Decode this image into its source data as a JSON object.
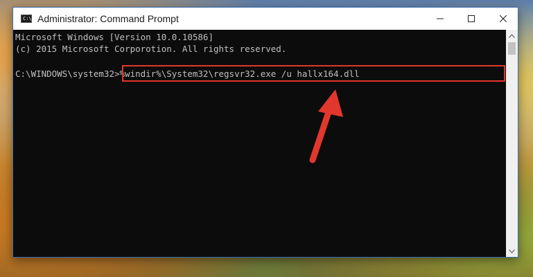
{
  "window": {
    "title": "Administrator: Command Prompt",
    "icon": "cmd-icon",
    "icon_text": "C:\\",
    "controls": {
      "minimize": "minimize-icon",
      "maximize": "maximize-icon",
      "close": "close-icon"
    }
  },
  "console": {
    "line1": "Microsoft Windows [Version 10.0.10586]",
    "line2": "(c) 2015 Microsoft Corporotion. All rights reserved.",
    "prompt": "C:\\WINDOWS\\system32>",
    "command": "%windir%\\System32\\regsvr32.exe /u hallx164.dll"
  },
  "annotation": {
    "highlight_color": "#e2372c",
    "arrow_color": "#e2372c"
  },
  "colors": {
    "console_bg": "#0c0c0c",
    "console_text": "#c0c0c0",
    "window_border": "#3c6fb0"
  }
}
